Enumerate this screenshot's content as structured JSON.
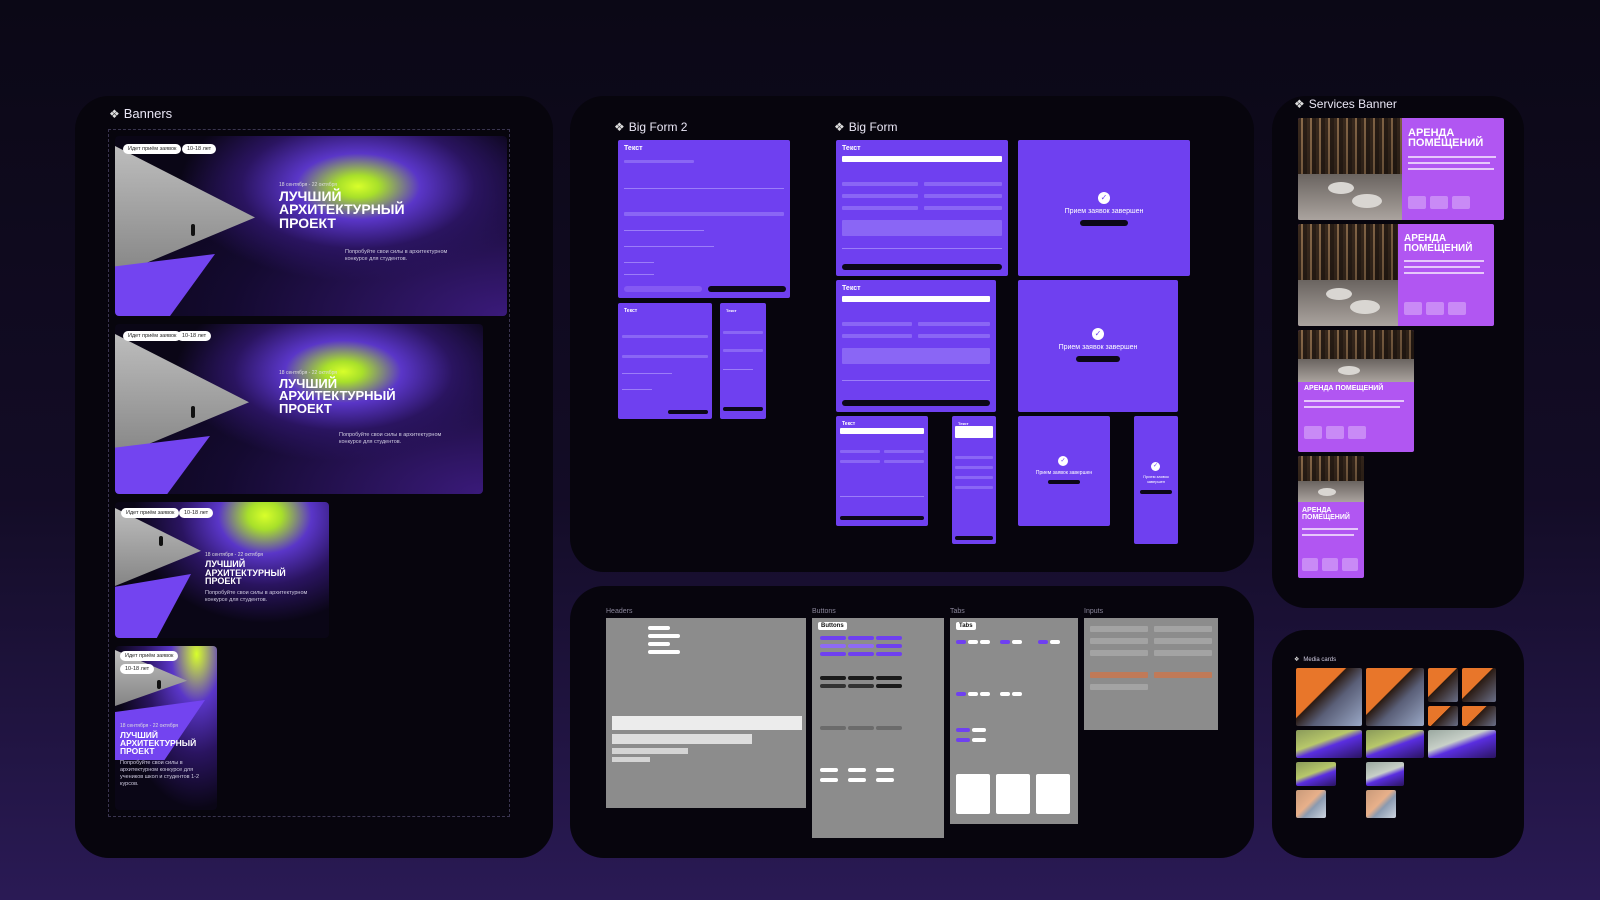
{
  "frames": {
    "banners": "Banners",
    "big_form_2": "Big Form 2",
    "big_form": "Big Form",
    "services_banner": "Services Banner",
    "media_cards": "Media cards",
    "headers": "Headers",
    "buttons": "Buttons",
    "tabs": "Tabs",
    "inputs": "Inputs"
  },
  "banner": {
    "pill_status": "Идет приём заявок",
    "pill_age": "10-18 лет",
    "date": "18 сентября - 22 октября",
    "title": "ЛУЧШИЙ АРХИТЕКТУРНЫЙ ПРОЕКТ",
    "desc": "Попробуйте свои силы в архитектурном конкурсе для студентов.",
    "desc_long": "Попробуйте свои силы в архитектурном конкурсе для учеников школ и студентов 1-2 курсов."
  },
  "form": {
    "title": "Текст",
    "done_text": "Прием заявок завершен"
  },
  "kit": {
    "buttons_title": "Buttons",
    "tabs_title": "Tabs"
  },
  "services": {
    "title": "АРЕНДА ПОМЕЩЕНИЙ"
  },
  "colors": {
    "accent": "#6f40f0",
    "services_accent": "#b156f2",
    "highlight": "#d8ff2a"
  }
}
